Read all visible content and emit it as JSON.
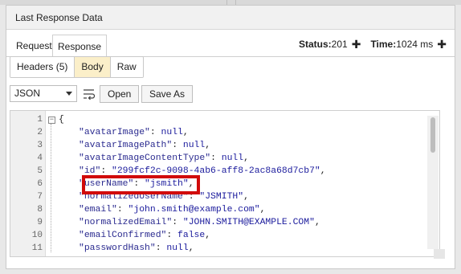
{
  "panel": {
    "title": "Last Response Data"
  },
  "tabs": [
    {
      "label": "Request",
      "active": false
    },
    {
      "label": "Response",
      "active": true
    }
  ],
  "status": {
    "label": "Status:",
    "value": "201",
    "time_label": "Time:",
    "time_value": "1024 ms"
  },
  "body_tabs": [
    {
      "label": "Headers (5)",
      "active": false
    },
    {
      "label": "Body",
      "active": true
    },
    {
      "label": "Raw",
      "active": false
    }
  ],
  "toolbar": {
    "format": "JSON",
    "open_label": "Open",
    "save_as_label": "Save As",
    "wrap_icon": "wrap-lines-icon"
  },
  "editor": {
    "lines": [
      {
        "num": "1",
        "text": "{"
      },
      {
        "num": "2",
        "key": "\"avatarImage\"",
        "value": "null",
        "vtype": "kw",
        "comma": ","
      },
      {
        "num": "3",
        "key": "\"avatarImagePath\"",
        "value": "null",
        "vtype": "kw",
        "comma": ","
      },
      {
        "num": "4",
        "key": "\"avatarImageContentType\"",
        "value": "null",
        "vtype": "kw",
        "comma": ","
      },
      {
        "num": "5",
        "key": "\"id\"",
        "value": "\"299fcf2c-9098-4ab6-aff8-2ac8a68d7cb7\"",
        "vtype": "s",
        "comma": ","
      },
      {
        "num": "6",
        "key": "\"userName\"",
        "value": "\"jsmith\"",
        "vtype": "s",
        "comma": ","
      },
      {
        "num": "7",
        "key": "\"normalizedUserName\"",
        "value": "\"JSMITH\"",
        "vtype": "s",
        "comma": ","
      },
      {
        "num": "8",
        "key": "\"email\"",
        "value": "\"john.smith@example.com\"",
        "vtype": "s",
        "comma": ","
      },
      {
        "num": "9",
        "key": "\"normalizedEmail\"",
        "value": "\"JOHN.SMITH@EXAMPLE.COM\"",
        "vtype": "s",
        "comma": ","
      },
      {
        "num": "10",
        "key": "\"emailConfirmed\"",
        "value": "false",
        "vtype": "kw",
        "comma": ","
      },
      {
        "num": "11",
        "key": "\"passwordHash\"",
        "value": "null",
        "vtype": "kw",
        "comma": ","
      }
    ]
  },
  "colors": {
    "highlight": "#d10a0a",
    "active_tab": "#fbefc9"
  }
}
